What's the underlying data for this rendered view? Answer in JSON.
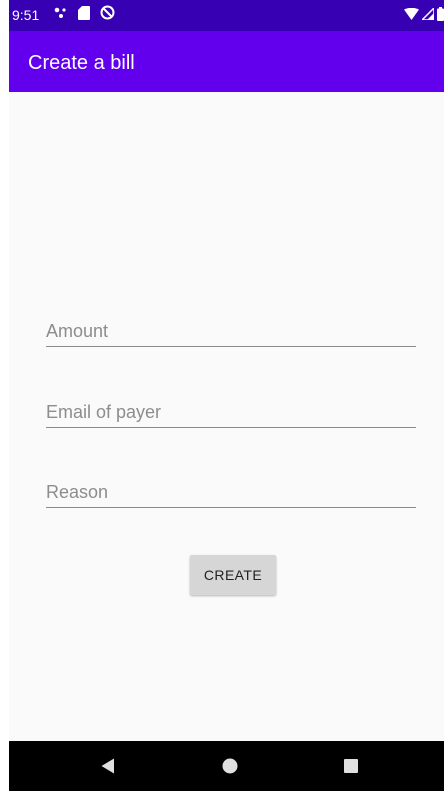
{
  "status_bar": {
    "time": "9:51",
    "left_icons": [
      "notification-dots-icon",
      "sd-card-icon",
      "do-not-disturb-icon"
    ],
    "right_icons": [
      "wifi-icon",
      "cell-signal-icon",
      "battery-icon"
    ],
    "background": "#3700b3"
  },
  "app_bar": {
    "title": "Create a bill",
    "background": "#6200ee"
  },
  "form": {
    "amount_placeholder": "Amount",
    "email_placeholder": "Email of payer",
    "reason_placeholder": "Reason",
    "create_label": "CREATE"
  },
  "nav_bar": {
    "icons": [
      "back-icon",
      "home-icon",
      "recents-icon"
    ]
  }
}
